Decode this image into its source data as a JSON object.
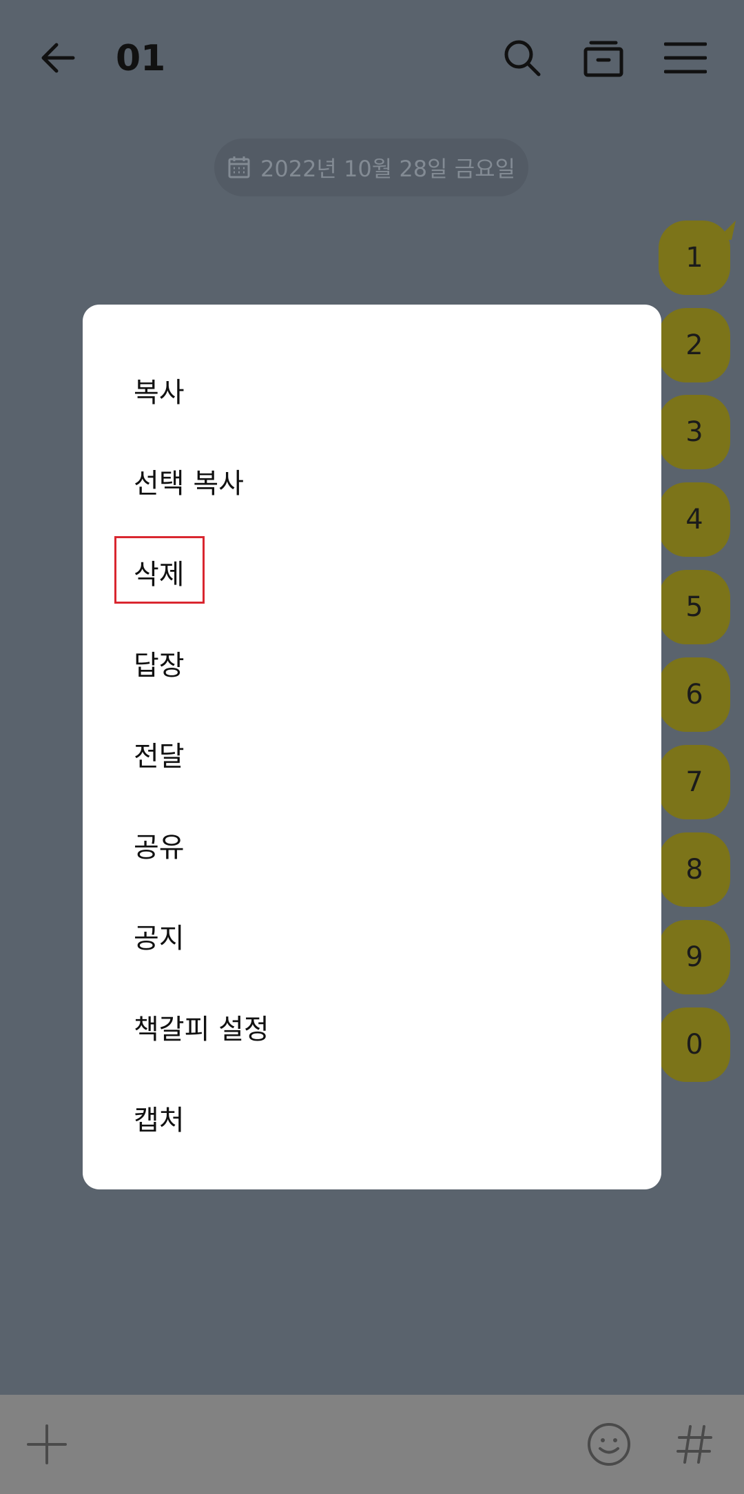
{
  "header": {
    "title": "01",
    "icons": [
      "back-arrow-icon",
      "search-icon",
      "drawer-icon",
      "hamburger-menu-icon"
    ]
  },
  "date_divider": {
    "icon": "calendar-icon",
    "text": "2022년 10월 28일 금요일"
  },
  "messages": [
    "1",
    "2",
    "3",
    "4",
    "5",
    "6",
    "7",
    "8",
    "9",
    "0"
  ],
  "context_menu": {
    "items": [
      "복사",
      "선택 복사",
      "삭제",
      "답장",
      "전달",
      "공유",
      "공지",
      "책갈피 설정",
      "캡처"
    ],
    "highlighted_item": "삭제"
  },
  "bottom_bar": {
    "icons": [
      "plus-icon",
      "emoji-icon",
      "hash-icon"
    ]
  },
  "colors": {
    "background": "#5a636d",
    "bubble": "#7c7419",
    "dialog": "#ffffff",
    "highlight": "#d9262f",
    "bottom_bar": "#828282"
  }
}
